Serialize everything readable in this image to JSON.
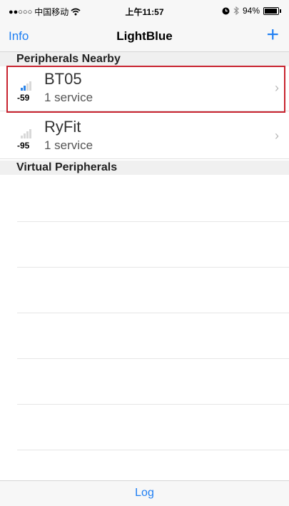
{
  "status_bar": {
    "signal_dots": "●●○○○",
    "carrier": "中国移动",
    "wifi_icon": "wifi-icon",
    "time": "上午11:57",
    "alarm_icon": "alarm-icon",
    "bluetooth_icon": "bluetooth-icon",
    "battery": "94%",
    "battery_level": 0.94
  },
  "nav": {
    "left_label": "Info",
    "title": "LightBlue",
    "add_icon": "plus-icon"
  },
  "sections": {
    "nearby": "Peripherals Nearby",
    "virtual": "Virtual Peripherals"
  },
  "devices": [
    {
      "name": "BT05",
      "services": "1 service",
      "rssi": "-59",
      "signal_color": "#2c84e8"
    },
    {
      "name": "RyFit",
      "services": "1 service",
      "rssi": "-95",
      "signal_color": "#cfcfcf"
    }
  ],
  "chevron": "›",
  "bottom": {
    "log_label": "Log"
  },
  "colors": {
    "accent": "#1f7ff3",
    "highlight": "#c8232f"
  }
}
